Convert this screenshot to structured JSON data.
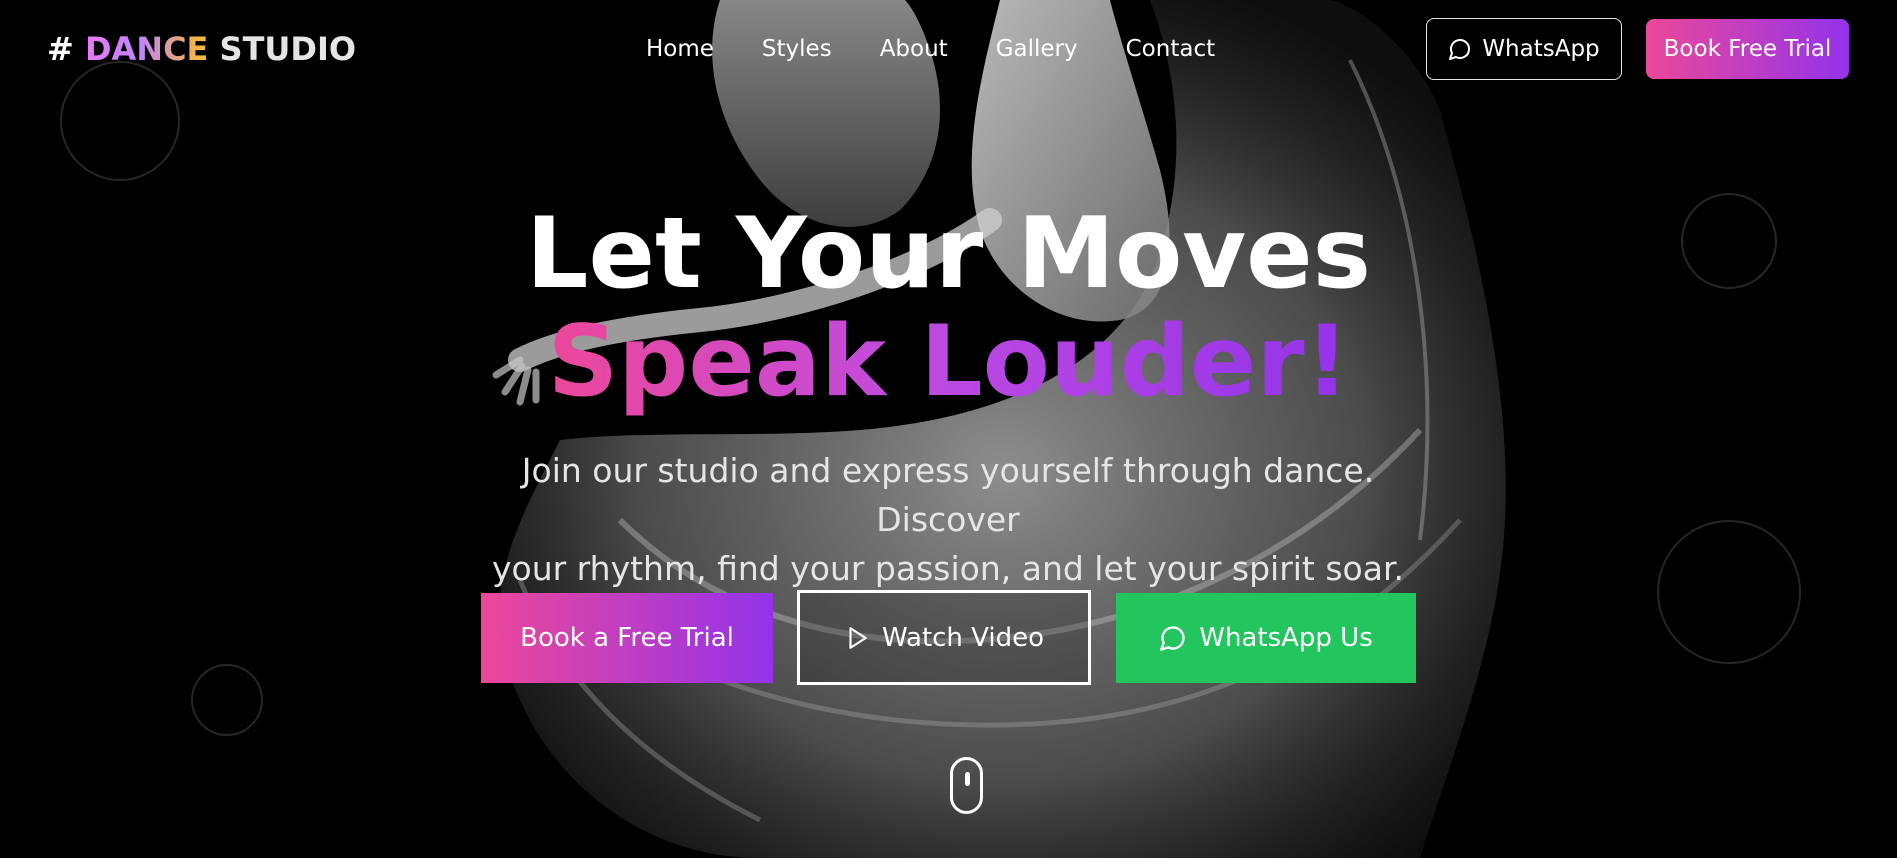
{
  "logo": {
    "hash": "#",
    "dance": "DANCE",
    "studio": "STUDIO"
  },
  "nav": {
    "links": [
      "Home",
      "Styles",
      "About",
      "Gallery",
      "Contact"
    ],
    "whatsapp_label": "WhatsApp",
    "book_label": "Book Free Trial"
  },
  "hero": {
    "title_line1": "Let Your Moves",
    "title_line2": "Speak Louder!",
    "subtitle_line1": "Join our studio and express yourself through dance. Discover",
    "subtitle_line2": "your rhythm, find your passion, and let your spirit soar.",
    "cta_book": "Book a Free Trial",
    "cta_video": "Watch Video",
    "cta_whatsapp": "WhatsApp Us"
  },
  "colors": {
    "gradient_start": "#ec4899",
    "gradient_end": "#9333ea",
    "whatsapp_green": "#22c55e",
    "background": "#000000"
  },
  "icons": {
    "chat": "message-circle-icon",
    "play": "play-icon",
    "scroll": "mouse-scroll-icon"
  }
}
